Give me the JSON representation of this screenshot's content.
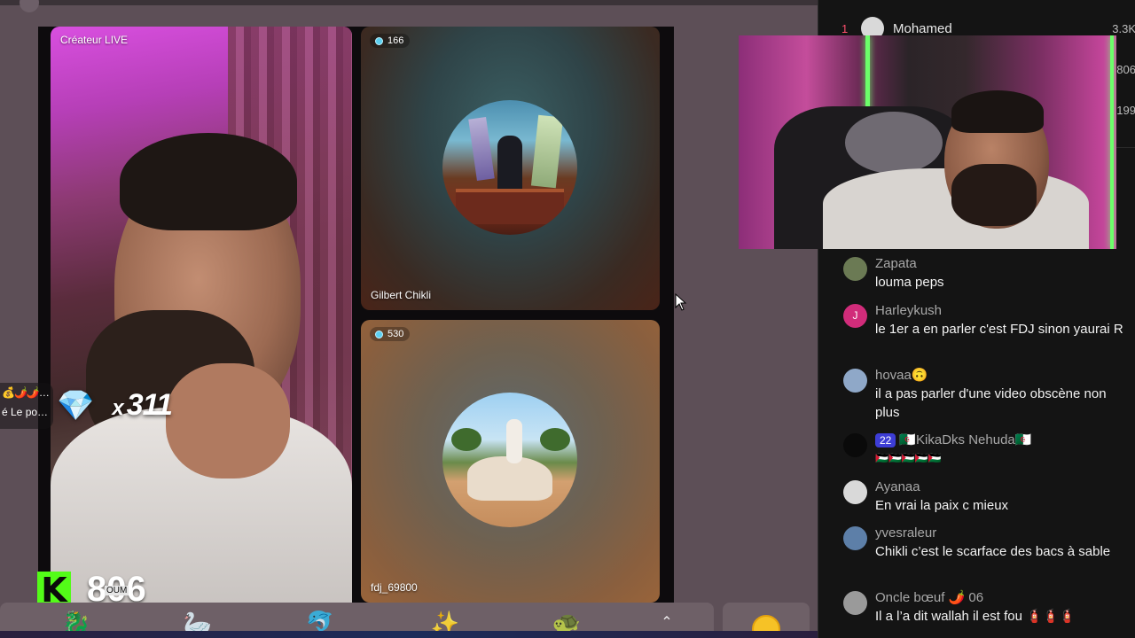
{
  "stage": {
    "host": {
      "label": "Créateur LIVE"
    },
    "guests": [
      {
        "viewers": "166",
        "name": "Gilbert Chikli"
      },
      {
        "viewers": "530",
        "name": "fdj_69800"
      }
    ],
    "gift_combo": {
      "icon": "💎",
      "multiplier": "x",
      "count": "311"
    },
    "side_notification": {
      "emojis": "💰🌶️🌶️…",
      "text": "é Le po…"
    },
    "kick_badge": {
      "logo": "K",
      "sublabel": "OUM",
      "count": "806"
    },
    "gift_bar": [
      {
        "icon": "🐉"
      },
      {
        "icon": "🦢"
      },
      {
        "icon": "🐬"
      },
      {
        "icon": "✨"
      },
      {
        "icon": "🐢"
      },
      {
        "icon": "⌃"
      }
    ]
  },
  "leaderboard": [
    {
      "rank": "1",
      "name": "Mohamed",
      "score": "3.3K"
    },
    {
      "rank": "",
      "name": "",
      "score": "806"
    },
    {
      "rank": "",
      "name": "",
      "score": "199"
    }
  ],
  "chat": [
    {
      "user": "Zapata",
      "text": "louma peps",
      "avatar_color": "#6b7a54",
      "initial": ""
    },
    {
      "user": "Harleykush",
      "text": "le 1er a en parler c'est FDJ sinon yaurai R",
      "avatar_color": "#d12c7a",
      "initial": "J"
    },
    {
      "user": "hovaa🙃",
      "text": "il a pas parler d'une video obscène non plus",
      "avatar_color": "#8fa8c8",
      "initial": ""
    },
    {
      "user": "🇩🇿KikaDks Nehuda🇩🇿",
      "badge": "22",
      "text": "🇵🇸🇵🇸🇵🇸🇵🇸🇵🇸",
      "avatar_color": "#0a0a0a",
      "initial": ""
    },
    {
      "user": "Ayanaa",
      "text": "En vrai la paix c mieux",
      "avatar_color": "#d9d9d9",
      "initial": ""
    },
    {
      "user": "yvesraleur",
      "text": "Chikli c’est le scarface des bacs à sable",
      "avatar_color": "#5d7fa8",
      "initial": ""
    },
    {
      "user": "Oncle bœuf 🌶️ 06",
      "text": "Il a l’a dit wallah il est fou 🧯🧯🧯",
      "avatar_color": "#9a9a9a",
      "initial": ""
    }
  ]
}
